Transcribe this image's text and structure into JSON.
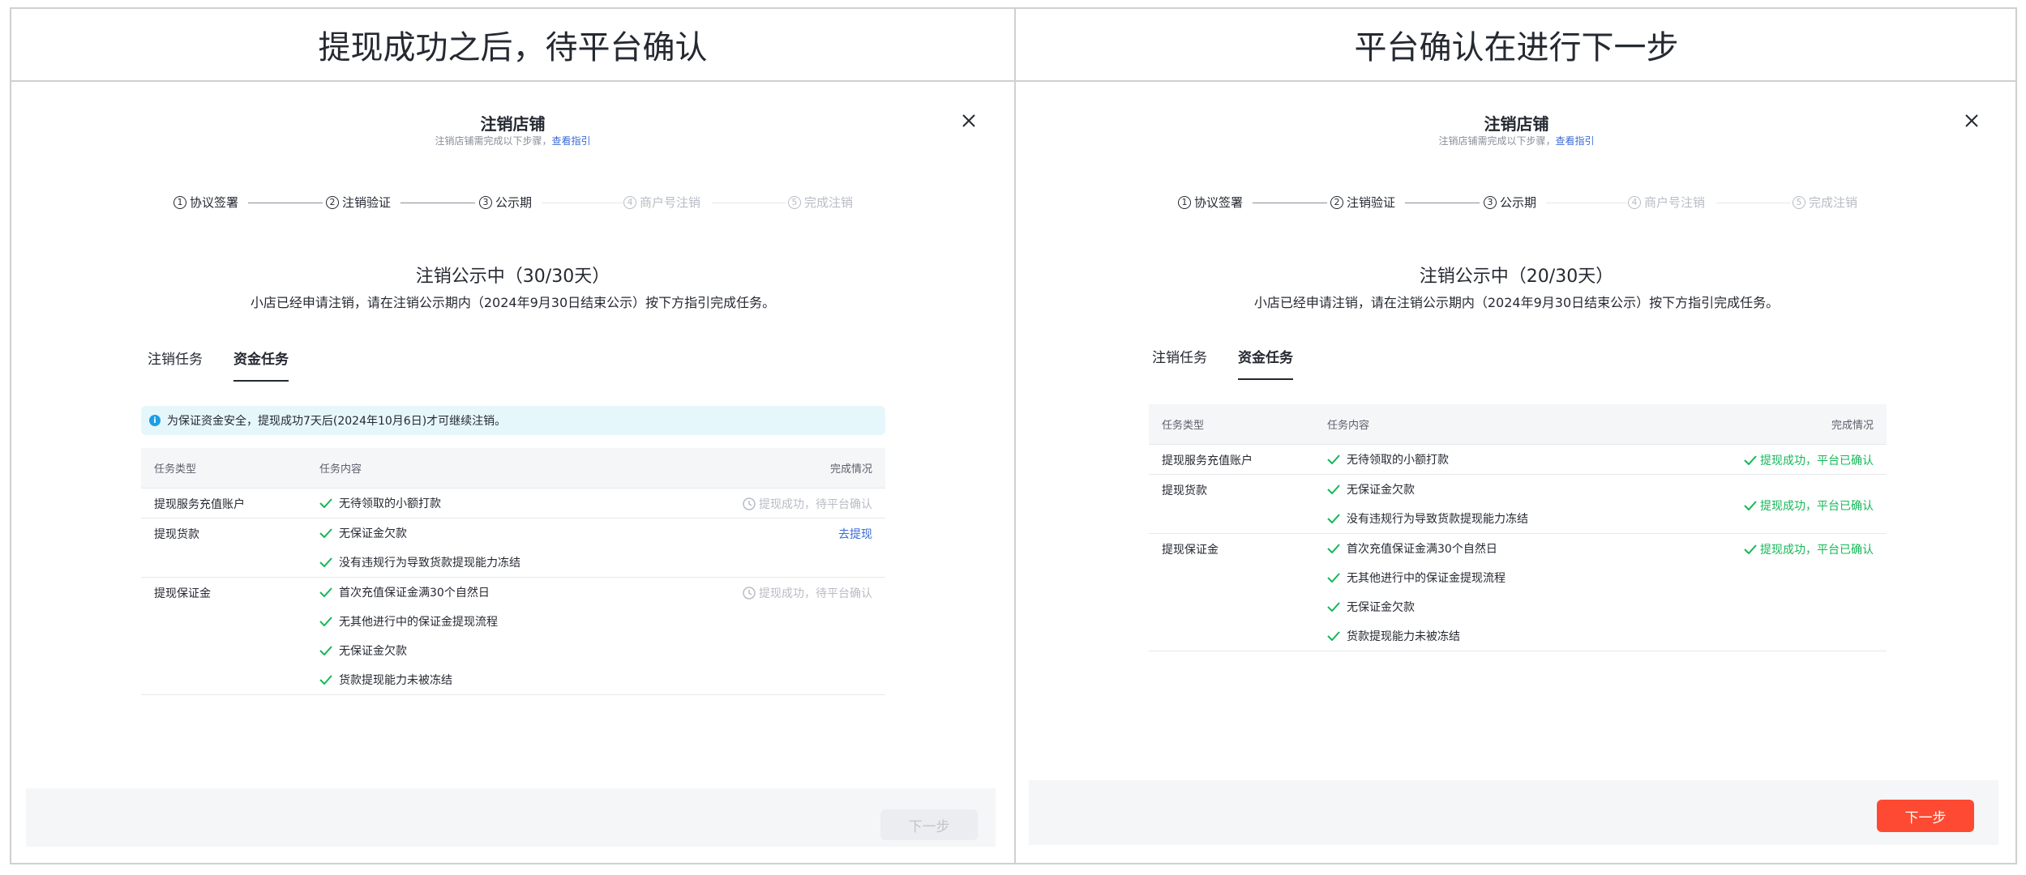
{
  "panels": [
    {
      "header": "提现成功之后，待平台确认",
      "modal": {
        "title": "注销店铺",
        "subtitle": "注销店铺需完成以下步骤，",
        "subtitle_link": "查看指引",
        "steps": [
          {
            "num": "1",
            "label": "协议签署",
            "state": "active"
          },
          {
            "num": "2",
            "label": "注销验证",
            "state": "active"
          },
          {
            "num": "3",
            "label": "公示期",
            "state": "active"
          },
          {
            "num": "4",
            "label": "商户号注销",
            "state": "inactive"
          },
          {
            "num": "5",
            "label": "完成注销",
            "state": "inactive"
          }
        ],
        "status_title": "注销公示中（30/30天）",
        "status_desc": "小店已经申请注销，请在注销公示期内（2024年9月30日结束公示）按下方指引完成任务。",
        "tabs": [
          {
            "label": "注销任务",
            "active": false
          },
          {
            "label": "资金任务",
            "active": true
          }
        ],
        "notice": "为保证资金安全，提现成功7天后(2024年10月6日)才可继续注销。",
        "table": {
          "headers": [
            "任务类型",
            "任务内容",
            "完成情况"
          ],
          "rows": [
            {
              "type": "提现服务充值账户",
              "items": [
                "无待领取的小额打款"
              ],
              "status": "提现成功，待平台确认",
              "status_kind": "pending"
            },
            {
              "type": "提现货款",
              "items": [
                "无保证金欠款",
                "没有违规行为导致货款提现能力冻结"
              ],
              "status": "去提现",
              "status_kind": "link"
            },
            {
              "type": "提现保证金",
              "items": [
                "首次充值保证金满30个自然日",
                "无其他进行中的保证金提现流程",
                "无保证金欠款",
                "货款提现能力未被冻结"
              ],
              "status": "提现成功，待平台确认",
              "status_kind": "pending"
            }
          ]
        },
        "next_button": "下一步",
        "next_state": "disabled"
      }
    },
    {
      "header": "平台确认在进行下一步",
      "modal": {
        "title": "注销店铺",
        "subtitle": "注销店铺需完成以下步骤，",
        "subtitle_link": "查看指引",
        "steps": [
          {
            "num": "1",
            "label": "协议签署",
            "state": "active"
          },
          {
            "num": "2",
            "label": "注销验证",
            "state": "active"
          },
          {
            "num": "3",
            "label": "公示期",
            "state": "active"
          },
          {
            "num": "4",
            "label": "商户号注销",
            "state": "inactive"
          },
          {
            "num": "5",
            "label": "完成注销",
            "state": "inactive"
          }
        ],
        "status_title": "注销公示中（20/30天）",
        "status_desc": "小店已经申请注销，请在注销公示期内（2024年9月30日结束公示）按下方指引完成任务。",
        "tabs": [
          {
            "label": "注销任务",
            "active": false
          },
          {
            "label": "资金任务",
            "active": true
          }
        ],
        "table": {
          "headers": [
            "任务类型",
            "任务内容",
            "完成情况"
          ],
          "rows": [
            {
              "type": "提现服务充值账户",
              "items": [
                "无待领取的小额打款"
              ],
              "status": "提现成功，平台已确认",
              "status_kind": "done"
            },
            {
              "type": "提现货款",
              "items": [
                "无保证金欠款",
                "没有违规行为导致货款提现能力冻结"
              ],
              "status": "提现成功，平台已确认",
              "status_kind": "done"
            },
            {
              "type": "提现保证金",
              "items": [
                "首次充值保证金满30个自然日",
                "无其他进行中的保证金提现流程",
                "无保证金欠款",
                "货款提现能力未被冻结"
              ],
              "status": "提现成功，平台已确认",
              "status_kind": "done"
            }
          ]
        },
        "next_button": "下一步",
        "next_state": "primary"
      }
    }
  ],
  "colors": {
    "primary_button": "#fe4a32",
    "link": "#3a6bd6",
    "success": "#14b858",
    "pending": "#b8bcc4",
    "notice_bg": "#e6f7fc",
    "info_icon": "#1a9fe6"
  }
}
